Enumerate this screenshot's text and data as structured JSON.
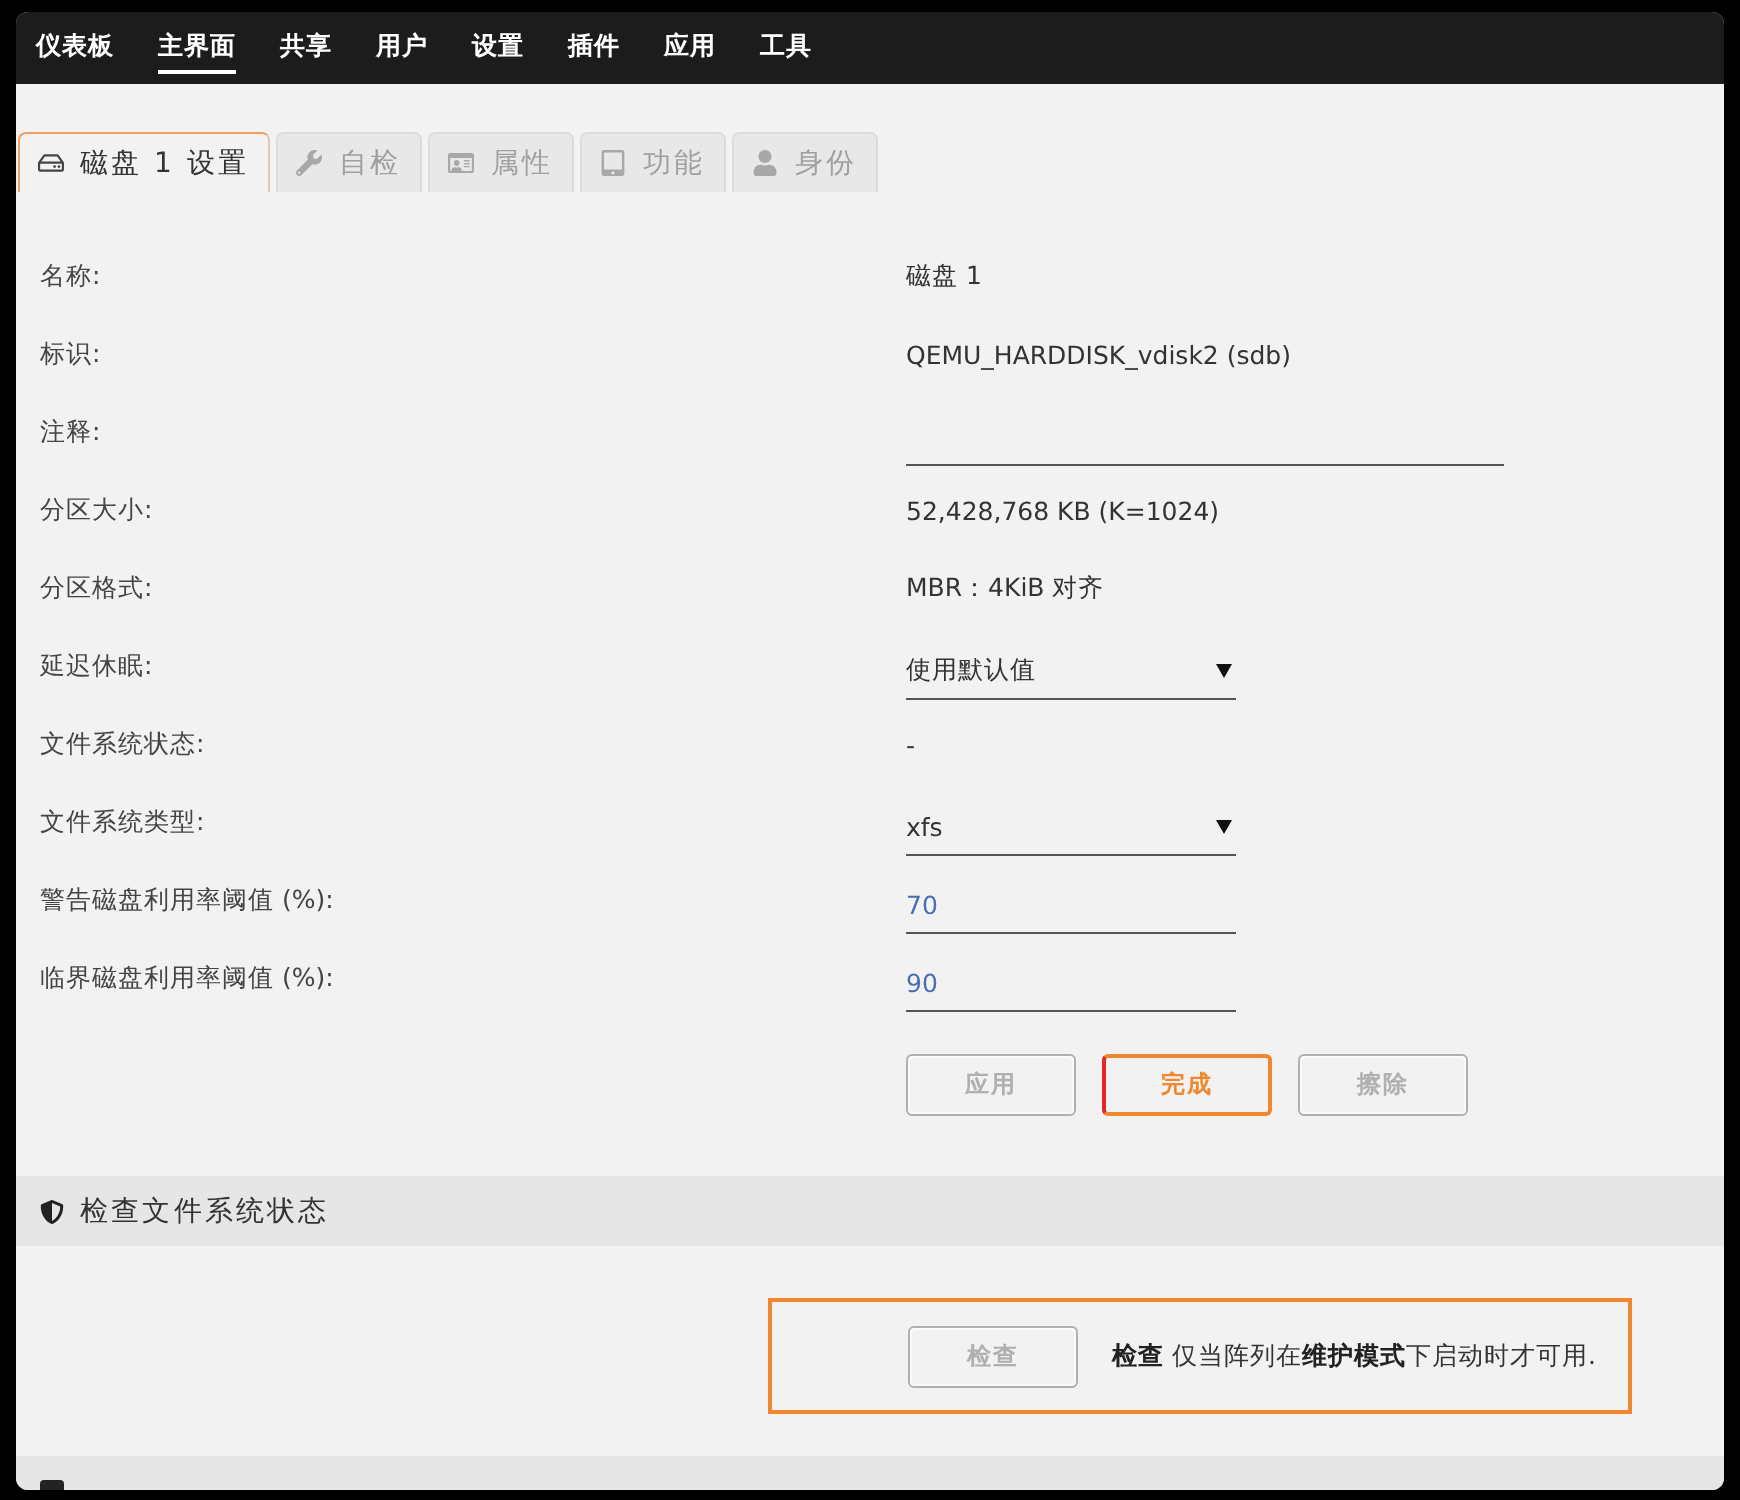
{
  "nav": [
    {
      "label": "仪表板",
      "selected": false
    },
    {
      "label": "主界面",
      "selected": true
    },
    {
      "label": "共享",
      "selected": false
    },
    {
      "label": "用户",
      "selected": false
    },
    {
      "label": "设置",
      "selected": false
    },
    {
      "label": "插件",
      "selected": false
    },
    {
      "label": "应用",
      "selected": false
    },
    {
      "label": "工具",
      "selected": false
    }
  ],
  "tabs": [
    {
      "label": "磁盘 1 设置",
      "selected": true
    },
    {
      "label": "自检",
      "selected": false
    },
    {
      "label": "属性",
      "selected": false
    },
    {
      "label": "功能",
      "selected": false
    },
    {
      "label": "身份",
      "selected": false
    }
  ],
  "settings": [
    {
      "kind": "text",
      "label": "名称:",
      "value": "磁盘 1"
    },
    {
      "kind": "text",
      "label": "标识:",
      "value": "QEMU_HARDDISK_vdisk2 (sdb)"
    },
    {
      "kind": "input",
      "label": "注释:"
    },
    {
      "kind": "text",
      "label": "分区大小:",
      "value": "52,428,768 KB (K=1024)"
    },
    {
      "kind": "text",
      "label": "分区格式:",
      "value": "MBR：4KiB 对齐"
    },
    {
      "kind": "select",
      "label": "延迟休眠:",
      "value": "使用默认值"
    },
    {
      "kind": "text",
      "label": "文件系统状态:",
      "value": "-"
    },
    {
      "kind": "select",
      "label": "文件系统类型:",
      "value": "xfs"
    },
    {
      "kind": "number",
      "label": "警告磁盘利用率阈值 (%):",
      "value": "70"
    },
    {
      "kind": "number",
      "label": "临界磁盘利用率阈值 (%):",
      "value": "90"
    }
  ],
  "buttons": [
    {
      "label": "应用",
      "disabled": true
    },
    {
      "label": "完成",
      "disabled": false
    },
    {
      "label": "擦除",
      "disabled": true
    }
  ],
  "check_section": {
    "title": "检查文件系统状态",
    "button": {
      "label": "检查",
      "disabled": true
    },
    "note": "**检查** 仅当阵列在**维护模式**下启动时才可用."
  }
}
